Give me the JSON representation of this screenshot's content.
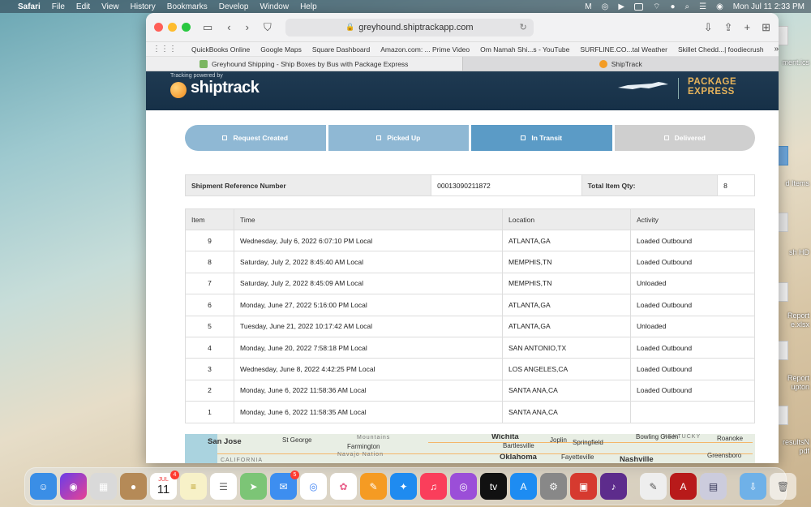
{
  "menubar": {
    "app": "Safari",
    "items": [
      "File",
      "Edit",
      "View",
      "History",
      "Bookmarks",
      "Develop",
      "Window",
      "Help"
    ],
    "clock": "Mon Jul 11  2:33 PM"
  },
  "desktop": {
    "labels": [
      "ment.ics",
      "d Items",
      "sh HD",
      "Report",
      "e.xlsx",
      "Report",
      "upton",
      "resultsN",
      "pdf"
    ]
  },
  "browser": {
    "url": "greyhound.shiptrackapp.com",
    "favorites": [
      "QuickBooks Online",
      "Google Maps",
      "Square Dashboard",
      "Amazon.com: ... Prime Video",
      "Om Namah Shi...s - YouTube",
      "SURFLINE.CO...tal Weather",
      "Skillet Chedd...| foodiecrush"
    ],
    "tabs": [
      {
        "label": "Greyhound Shipping - Ship Boxes by Bus with Package Express",
        "icon": "greyhound-favicon"
      },
      {
        "label": "ShipTrack",
        "icon": "shiptrack-favicon"
      }
    ]
  },
  "header": {
    "powered_by": "Tracking powered by",
    "logo": "shiptrack",
    "partner_line1": "PACKAGE",
    "partner_line2": "EXPRESS"
  },
  "progress": {
    "steps": [
      "Request Created",
      "Picked Up",
      "In Transit",
      "Delivered"
    ],
    "current": "In Transit"
  },
  "reference": {
    "ref_label": "Shipment Reference Number",
    "ref_value": "00013090211872",
    "qty_label": "Total Item Qty:",
    "qty_value": "8"
  },
  "tracking": {
    "columns": [
      "Item",
      "Time",
      "Location",
      "Activity"
    ],
    "rows": [
      {
        "item": "9",
        "time": "Wednesday, July 6, 2022 6:07:10 PM Local",
        "location": "ATLANTA,GA",
        "activity": "Loaded Outbound"
      },
      {
        "item": "8",
        "time": "Saturday, July 2, 2022 8:45:40 AM Local",
        "location": "MEMPHIS,TN",
        "activity": "Loaded Outbound"
      },
      {
        "item": "7",
        "time": "Saturday, July 2, 2022 8:45:09 AM Local",
        "location": "MEMPHIS,TN",
        "activity": "Unloaded"
      },
      {
        "item": "6",
        "time": "Monday, June 27, 2022 5:16:00 PM Local",
        "location": "ATLANTA,GA",
        "activity": "Loaded Outbound"
      },
      {
        "item": "5",
        "time": "Tuesday, June 21, 2022 10:17:42 AM Local",
        "location": "ATLANTA,GA",
        "activity": "Unloaded"
      },
      {
        "item": "4",
        "time": "Monday, June 20, 2022 7:58:18 PM Local",
        "location": "SAN ANTONIO,TX",
        "activity": "Loaded Outbound"
      },
      {
        "item": "3",
        "time": "Wednesday, June 8, 2022 4:42:25 PM Local",
        "location": "LOS ANGELES,CA",
        "activity": "Loaded Outbound"
      },
      {
        "item": "2",
        "time": "Monday, June 6, 2022 11:58:36 AM Local",
        "location": "SANTA ANA,CA",
        "activity": "Loaded Outbound"
      },
      {
        "item": "1",
        "time": "Monday, June 6, 2022 11:58:35 AM Local",
        "location": "SANTA ANA,CA",
        "activity": ""
      }
    ]
  },
  "map": {
    "labels": [
      "San Jose",
      "St George",
      "Mountains",
      "Farmington",
      "Navajo Nation",
      "Wichita",
      "Bartlesville",
      "Joplin",
      "Springfield",
      "Bowling Green",
      "KENTUCKY",
      "Roanoke",
      "Oklahoma",
      "Fayetteville",
      "Nashville",
      "Greensboro",
      "CALIFORNIA"
    ]
  },
  "dock": {
    "calendar_month": "JUL",
    "calendar_day": "11",
    "calendar_badge": "4",
    "mail_badge": "5"
  },
  "colors": {
    "header_bg": "#1f3a52",
    "step_done": "#8fb8d4",
    "step_current": "#5b9bc6",
    "step_pending": "#cfcfcf",
    "partner_gold": "#e6b35b"
  }
}
